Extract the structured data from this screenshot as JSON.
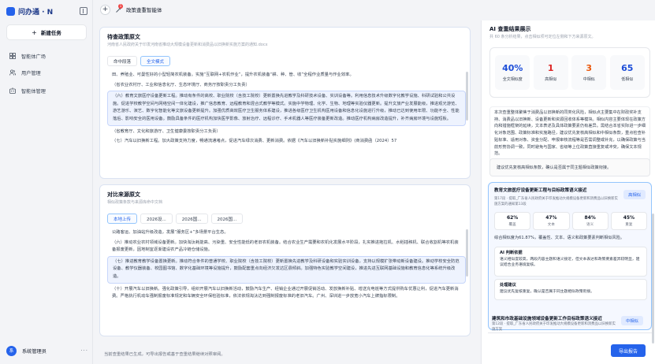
{
  "app": {
    "logo": "问办通 · N"
  },
  "sidebar": {
    "new_task": "新建任务",
    "items": [
      {
        "label": "智能体广场",
        "icon": "grid-icon"
      },
      {
        "label": "用户管理",
        "icon": "users-icon"
      },
      {
        "label": "智能体管理",
        "icon": "agent-manage-icon"
      }
    ],
    "user": {
      "avatar": "系",
      "name": "系统管理员"
    }
  },
  "topbar": {
    "agent_name": "政策查重智能体",
    "badge": "1"
  },
  "doc1": {
    "title": "待查政策原文",
    "subtitle": "河南省人民政府关于印发河南省推动大规模设备更新和消费品以旧换新实施方案的通知.docx",
    "tabs": [
      "命中段落",
      "全文模式"
    ],
    "paras": [
      "田、养殖业、可曼性好的小型轻简农机装备。实施“互联网+农机作业”，提升农机装备“耕、种、管、收”全程作业质量与作业效率。",
      "（省农业农村厅、工业和信息化厅、生态环境厅、商务厅按职责分工负责）",
      "（六）教育文旅医疗设备更新工程。推动有条件的高校、职业院校（含技工院校）更新置换先进教学及科研技术设备、实训设备等。利用信息技术升级数字化教学设施、科研试验和公共设施。促进学校教学空间与网络空间一体化建设，推广信息教育、远程教育和混合式教学等模式。实施中学物理、化学、生物、地理等实验仪器更新。提升文旅产业发展能级，推进观光游览、游艺游乐、演艺、数字化智能化等文旅设备更新提升。加强优质高效医疗卫生服务体系建设，推进各级医疗卫生机构医用设备和信息化设施进行升级，推动已达到使用年限、功能不全、性能落后、影响安全的医用设备。鼓励具备条件的医疗机构加快医学影像、放射治疗、远程诊疗、手术机器人等医疗装备更新改造。推动医疗机构病房改造提升，补齐病房环境与设施短板。",
      "（省教育厅、文化和旅游厅、卫生健康委按职责分工负责）",
      "（七）汽车以旧换新工程。加大政策支持力度，畅通流通堵点，促进汽车绿次消费、更新消费。依据《汽车以旧换新补贴实施细则》(商消费函（2024）57"
    ]
  },
  "doc2": {
    "title": "对比来源原文",
    "subtitle": "相似政策条款与来源库命中文档",
    "tabs": [
      "本地上传",
      "2026设...",
      "2026国...",
      "2026国..."
    ],
    "paras": [
      "公路客运、加油站升级改造，发展“服务区+”多场景平台生态。",
      "（六）推动农业农村领域设备更新。加快淘汰耗能高、污染重、安全性能低的老旧农机装备。结合农业生产需要和农机化发展水平阶段，扎实推进拖拉机、水稻插秧机、联合收割机等农机装备报废更新，因地制宜逐渐建设农产品冷链仓储设施。",
      "（七）推进教育教学设备置换更新。推动符合条件的普通学校、职业院校（含技工院校）更新置换先进教学及科研设备和实验实训设备，支持以规模扩张带动新设备建设。推动学校安全防范设备、教学仪器装备、校园图书馆、数字化基础环境等设施提升，鼓励配套重点向经济欠发达区县倾斜。加强特色实验教学空间建设，推进先进互联网基础设施和教育信息化等系统升级改造。",
      "（十）开展汽车以旧换新。强化政策引导，组织开展汽车以旧换新活动，鼓励汽车生产、经销企业通过开展促销活动、发放换新补贴、增送充电桩等方式提供购车优惠让利，促进汽车更新消费。严格执行机动车强制报废标准规定和车辆安全环保检验标准，依法依规淘汰达到强制报废标准的老旧汽车。广州、深圳进一步放宽小汽车上牌指标限制。"
    ]
  },
  "status": {
    "text": "当前查重结果已生成，可导出报告或基于查重结果继续对照审阅。",
    "export": "导出报告"
  },
  "result": {
    "title": "AI 查重结果展示",
    "subtitle": "共 60 条分析结果，点击相似项可定位左侧和下方来源原文。",
    "stats": [
      {
        "value": "40%",
        "label": "全文相似度",
        "color": "#1d4ed8"
      },
      {
        "value": "1",
        "label": "高相似",
        "color": "#dc2626"
      },
      {
        "value": "3",
        "label": "中相似",
        "color": "#ea580c"
      },
      {
        "value": "65",
        "label": "低相似",
        "color": "#1d4ed8"
      }
    ],
    "summary": "本次查重整体聚焦于消费品以旧换新的同类化风险，相似点主要集中在财政奖补支持、消费品以旧换新、设备更新和资源回收体系等模块。相似内容主要体现在政策方向和措施框架的延续，文本表述及具体政策要素仍有差异。需结合本省实际进一步细化对象范围、政策标准和实施路径，建议优先复核高相似和中相似条款，重点检查补贴标准、适用对象、资金分配、申报审核流程等是否需调整或补充，以确保政策与当前形势协调一致，同时避免与国家、省级等上位政策直接重复或冲突，确保文本规范。",
    "suggestion": "建议优先复核高相似条款，确认是否属于同主题相似政策衔接。",
    "match": {
      "title": "教育文旅医疗设备更新工程与目标政策语义接近",
      "subtitle": "第17段 · 提取_广东省人民政府关于印发推动大规模设备更新和消费品以旧换新实施方案的通知第13段",
      "tag": "高相似",
      "stats": [
        {
          "value": "62%",
          "label": "覆盖"
        },
        {
          "value": "47%",
          "label": "文本"
        },
        {
          "value": "84%",
          "label": "语义"
        },
        {
          "value": "45%",
          "label": "重复"
        }
      ],
      "line": "综合相似度为61.87%，覆盖性、文本、语义和政策要素判断相似风险。",
      "ai_title": "AI 判断依据",
      "ai_text": "语义相似度较高，两段内容主题和语义接近，但文本表达和政策要素差异较明显，建议结合业务语境复核。",
      "handle_title": "处理建议",
      "handle_text": "建议优先复核重复，确认是否属于同主题相似政策衔接。"
    },
    "match2": {
      "title": "建筑和市政基础设施领域设备更新工作目标政策语义接近",
      "subtitle": "第12段 · 提取_广东省人民政府关于印发推动大规模设备更新和消费品以旧换新实施方案",
      "tag": "中相似"
    }
  }
}
